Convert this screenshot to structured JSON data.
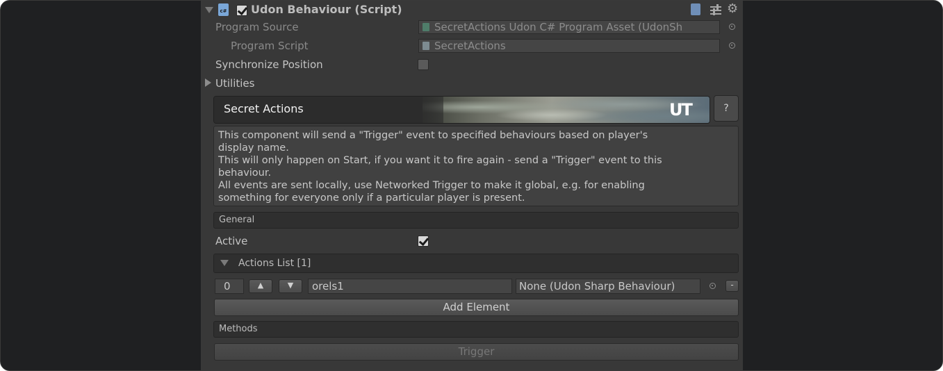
{
  "header": {
    "title": "Udon Behaviour (Script)",
    "icons": [
      "csharp-script-icon",
      "help-book-icon",
      "presets-icon",
      "gear-icon"
    ]
  },
  "fields": {
    "program_source_label": "Program Source",
    "program_source_value": "SecretActions Udon C# Program Asset (UdonSh",
    "program_script_label": "Program Script",
    "program_script_value": "SecretActions",
    "sync_position_label": "Synchronize Position",
    "sync_position_checked": false,
    "utilities_label": "Utilities"
  },
  "banner": {
    "title": "Secret Actions",
    "logo": "UT",
    "help_label": "?"
  },
  "description": {
    "lines": [
      "This component will send a \"Trigger\" event to specified behaviours based on player's",
      "display name.",
      "This will only happen on Start, if you want it to fire again - send a \"Trigger\" event to this",
      "behaviour.",
      "All events are sent locally, use Networked Trigger to make it global, e.g. for enabling",
      "something for everyone only if a particular player is present."
    ]
  },
  "general": {
    "section_label": "General",
    "active_label": "Active",
    "active_checked": true,
    "actions_list_label": "Actions List [1]",
    "element": {
      "index": "0",
      "name": "orels1",
      "target": "None (Udon Sharp Behaviour)",
      "remove_label": "-"
    },
    "add_element_label": "Add Element"
  },
  "methods": {
    "section_label": "Methods",
    "trigger_label": "Trigger"
  }
}
